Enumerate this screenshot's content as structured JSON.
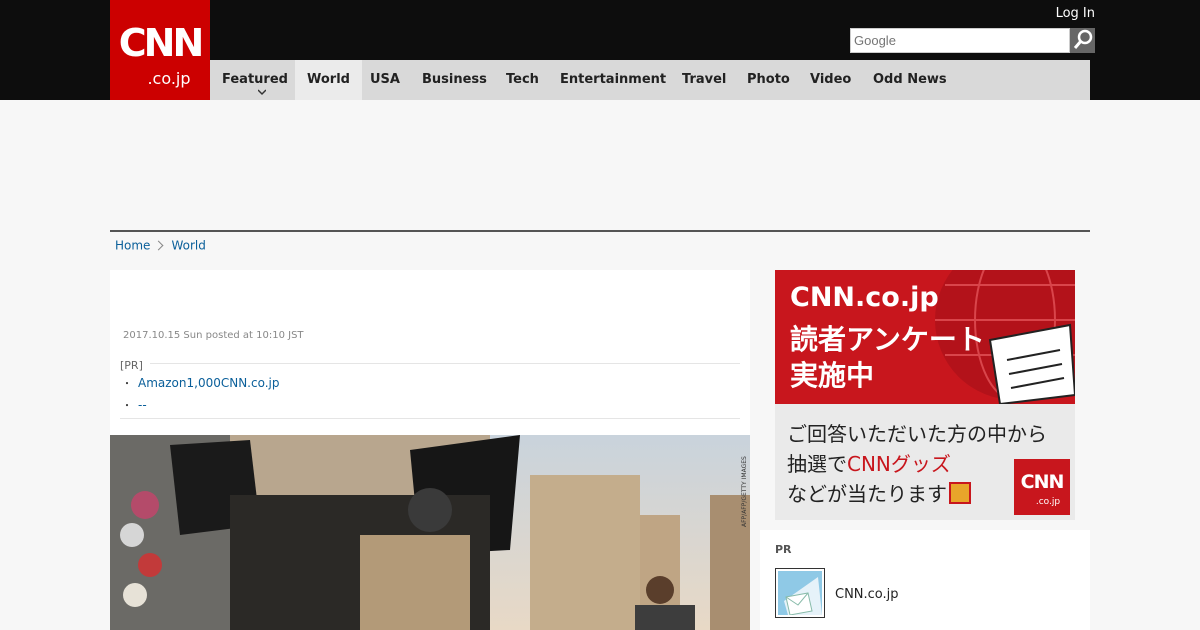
{
  "header": {
    "logo_text": "CNN",
    "logo_sub": ".co.jp",
    "login_label": "Log In",
    "search_placeholder": "Google",
    "brand_color": "#cc0000"
  },
  "nav": {
    "items": [
      {
        "label": "Featured"
      },
      {
        "label": "World"
      },
      {
        "label": "USA"
      },
      {
        "label": "Business"
      },
      {
        "label": "Tech"
      },
      {
        "label": "Entertainment"
      },
      {
        "label": "Travel"
      },
      {
        "label": "Photo"
      },
      {
        "label": "Video"
      },
      {
        "label": "Odd News"
      }
    ]
  },
  "breadcrumb": {
    "home": "Home",
    "current": "World"
  },
  "article": {
    "posted": "2017.10.15 Sun posted at 10:10 JST",
    "pr_label": "[PR]",
    "pr_links": [
      {
        "bullet": "・",
        "text": "Amazon1,000CNN.co.jp"
      },
      {
        "bullet": "・",
        "text": "--"
      }
    ],
    "photo_credit": "AFP/AFP/GETTY IMAGES"
  },
  "banner": {
    "line1": "CNN.co.jp",
    "line2": "読者アンケート",
    "line3": "実施中",
    "bottom_line1": "ご回答いただいた方の中から",
    "bottom_line2_a": "抽選で",
    "bottom_line2_b": "CNNグッズ",
    "bottom_line3": "などが当たります",
    "logo_text": "CNN",
    "logo_sub": ".co.jp"
  },
  "pr_box": {
    "title": "PR",
    "item_name": "CNN.co.jp"
  }
}
